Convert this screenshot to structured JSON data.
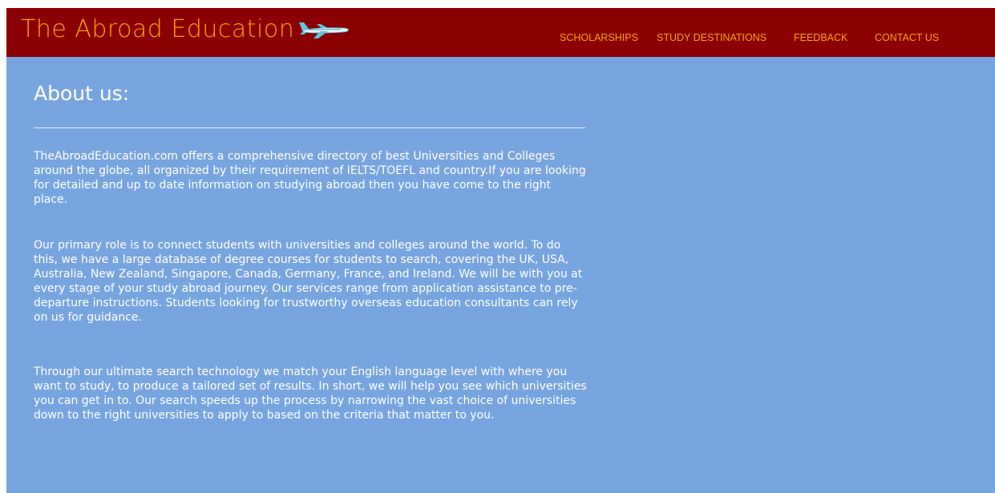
{
  "header": {
    "brand": "The Abroad Education",
    "brand_icon": "airplane-icon",
    "brand_color": "#f5a300",
    "background_color": "#8b0000",
    "nav": [
      {
        "label": "SCHOLARSHIPS"
      },
      {
        "label": "STUDY DESTINATIONS"
      },
      {
        "label": "FEEDBACK"
      },
      {
        "label": "CONTACT US"
      }
    ]
  },
  "main": {
    "background_color": "#78a5df",
    "title": "About us:",
    "paragraphs": [
      "TheAbroadEducation.com offers a comprehensive directory of best Universities and Colleges around the globe, all organized by their requirement of IELTS/TOEFL and country.If you are looking for detailed and up to date information on studying abroad then you have come to the right place.",
      "Our primary role is to connect students with universities and colleges around the world. To do this, we have a large database of degree courses for students to search, covering the UK, USA, Australia, New Zealand, Singapore, Canada, Germany, France, and Ireland. We will be with you at every stage of your study abroad journey. Our services range from application assistance to pre-departure instructions. Students looking for trustworthy overseas education consultants can rely on us for guidance.",
      "Through our ultimate search technology we match your English language level with where you want to study, to produce a tailored set of results. In short, we will help you see which universities you can get in to. Our search speeds up the process by narrowing the vast choice of universities down to the right universities to apply to based on the criteria that matter to you."
    ]
  }
}
